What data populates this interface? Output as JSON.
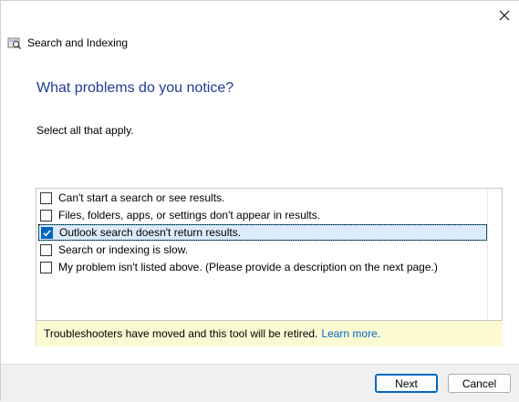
{
  "window": {
    "title": "Search and Indexing",
    "close_label": "Close"
  },
  "main": {
    "heading": "What problems do you notice?",
    "instruction": "Select all that apply."
  },
  "problems": [
    {
      "label": "Can't start a search or see results.",
      "checked": false
    },
    {
      "label": "Files, folders, apps, or settings don't appear in results.",
      "checked": false
    },
    {
      "label": "Outlook search doesn't return results.",
      "checked": true
    },
    {
      "label": "Search or indexing is slow.",
      "checked": false
    },
    {
      "label": "My problem isn't listed above. (Please provide a description on the next page.)",
      "checked": false
    }
  ],
  "banner": {
    "text": "Troubleshooters have moved and this tool will be retired.",
    "link": "Learn more."
  },
  "footer": {
    "next_label": "Next",
    "cancel_label": "Cancel"
  },
  "colors": {
    "heading": "#1e3c96",
    "checkbox_checked": "#0067c0",
    "selection": "#dcebfc",
    "banner_bg": "#fcfad2",
    "link": "#0066cc"
  },
  "icons": {
    "app": "search-indexing-icon",
    "close": "close-icon",
    "check": "checkmark-icon"
  }
}
